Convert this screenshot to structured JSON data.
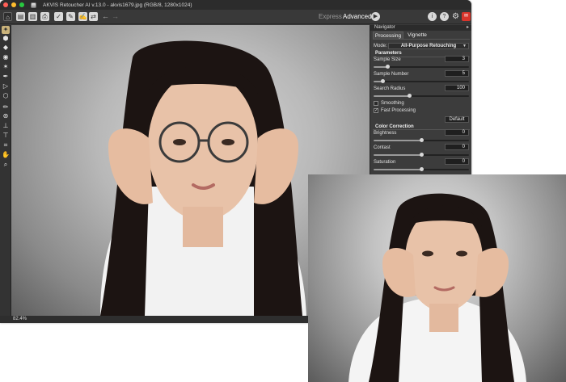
{
  "window": {
    "title": "AKVIS Retoucher AI v.13.0 - akvis1679.jpg (RGB/8, 1280x1024)",
    "traffic_lights": {
      "close": "#ff5f57",
      "minimize": "#febc2e",
      "zoom": "#28c840"
    }
  },
  "toolbar": {
    "buttons": [
      "home-icon",
      "open-file-icon",
      "save-icon",
      "print-icon",
      "run-icon",
      "batch-icon",
      "preset-icon",
      "share-icon"
    ],
    "undo_glyph": "←",
    "redo_glyph": "→",
    "modes": {
      "express": "Express",
      "advanced": "Advanced"
    },
    "play_glyph": "▶",
    "right_buttons": {
      "info": "i",
      "help": "?",
      "settings": "⚙"
    }
  },
  "tools": [
    "inpainting-icon",
    "magic-tube-icon",
    "eraser-icon",
    "fill-icon",
    "magic-wand-icon",
    "color-picker-icon",
    "selection-icon",
    "lasso-icon",
    "brush-icon",
    "clone-icon",
    "stamp-icon",
    "healing-icon",
    "crop-icon",
    "hand-icon",
    "zoom-icon"
  ],
  "status": {
    "zoom": "82.4%"
  },
  "navigator": {
    "title": "Navigator",
    "arrow": "▸"
  },
  "tabs": {
    "processing": "Processing",
    "vignette": "Vignette"
  },
  "panel": {
    "mode_label": "Mode:",
    "mode_value": "All-Purpose Retouching",
    "parameters_title": "Parameters",
    "sample_size": {
      "label": "Sample Size",
      "value": "3",
      "fraction": 0.15
    },
    "sample_number": {
      "label": "Sample Number",
      "value": "5",
      "fraction": 0.1
    },
    "search_radius": {
      "label": "Search Radius",
      "value": "100",
      "fraction": 0.38
    },
    "smoothing": {
      "label": "Smoothing",
      "checked": false
    },
    "fast_processing": {
      "label": "Fast Processing",
      "checked": true
    },
    "default_button": "Default",
    "color_correction_title": "Color Correction",
    "brightness": {
      "label": "Brightness",
      "value": "0",
      "fraction": 0.5
    },
    "contrast": {
      "label": "Contast",
      "value": "0",
      "fraction": 0.5
    },
    "saturation": {
      "label": "Saturation",
      "value": "0",
      "fraction": 0.5
    }
  },
  "colors": {
    "accent": "#1e90ff",
    "panel_bg": "#3c3c3c",
    "titlebar_bg": "#2c2c2c",
    "alert": "#d9342b"
  }
}
